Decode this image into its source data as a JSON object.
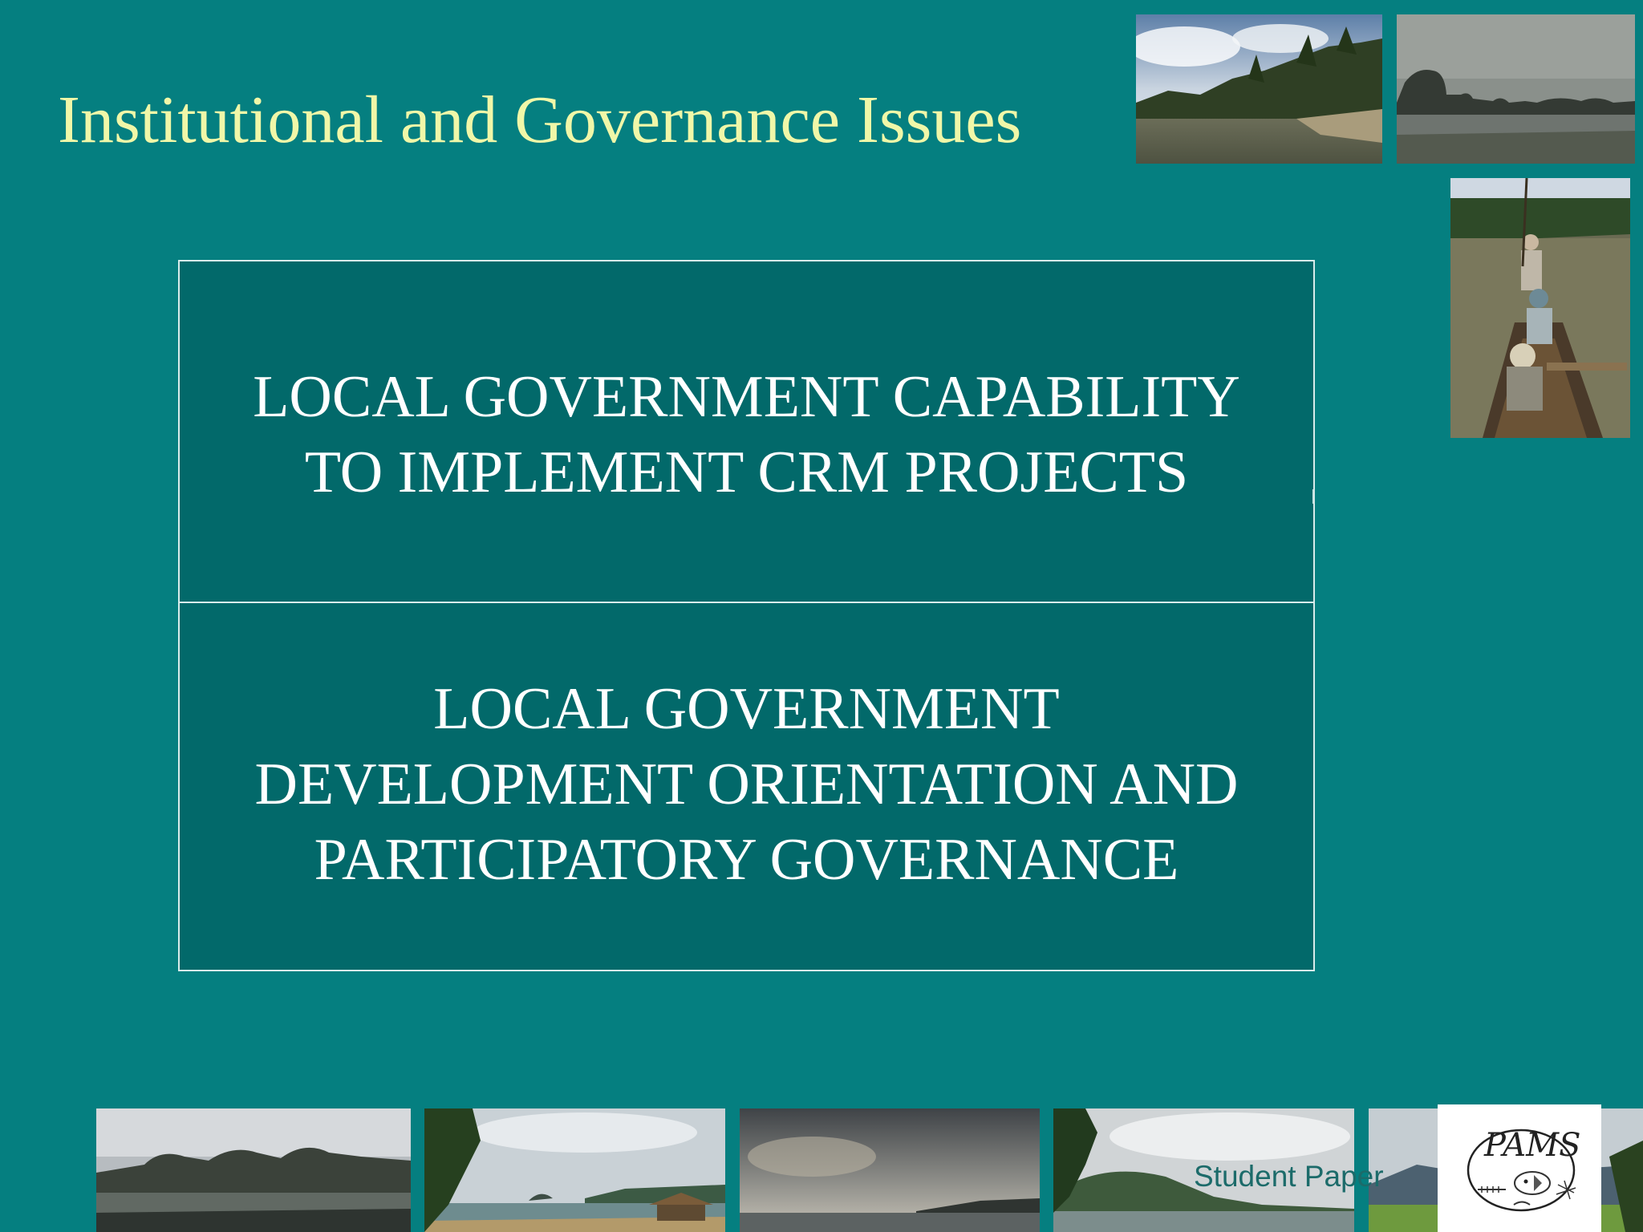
{
  "slide": {
    "title": "Institutional and Governance Issues",
    "footer_label": "Student Paper",
    "logo_text": "PAMS",
    "colors": {
      "background": "#057f80",
      "title": "#f0f7a8",
      "table_fill": "#02696a",
      "table_border": "#d9eceb",
      "table_text": "#ffffff",
      "footer_text": "#1c6b6a"
    }
  },
  "table": {
    "rows": [
      {
        "line1": "LOCAL GOVERNMENT CAPABILITY",
        "line2": "TO IMPLEMENT CRM PROJECTS"
      },
      {
        "line1": "LOCAL GOVERNMENT",
        "line2": "DEVELOPMENT ORIENTATION AND",
        "line3": "PARTICIPATORY GOVERNANCE"
      }
    ]
  },
  "photos": [
    {
      "name": "river-bank-photo",
      "subject": "river bank with palm trees"
    },
    {
      "name": "rocky-islands-photo",
      "subject": "rocky islands on calm sea"
    },
    {
      "name": "boat-people-photo",
      "subject": "people in a boat on a river"
    },
    {
      "name": "coastal-hills-photo",
      "subject": "coastal hills and shoreline"
    },
    {
      "name": "beach-hut-photo",
      "subject": "beach with hut and islands"
    },
    {
      "name": "cloudy-sea-photo",
      "subject": "cloudy sky over sea"
    },
    {
      "name": "bay-trees-photo",
      "subject": "bay with trees and hills"
    },
    {
      "name": "green-field-photo",
      "subject": "green field and mountains"
    }
  ]
}
